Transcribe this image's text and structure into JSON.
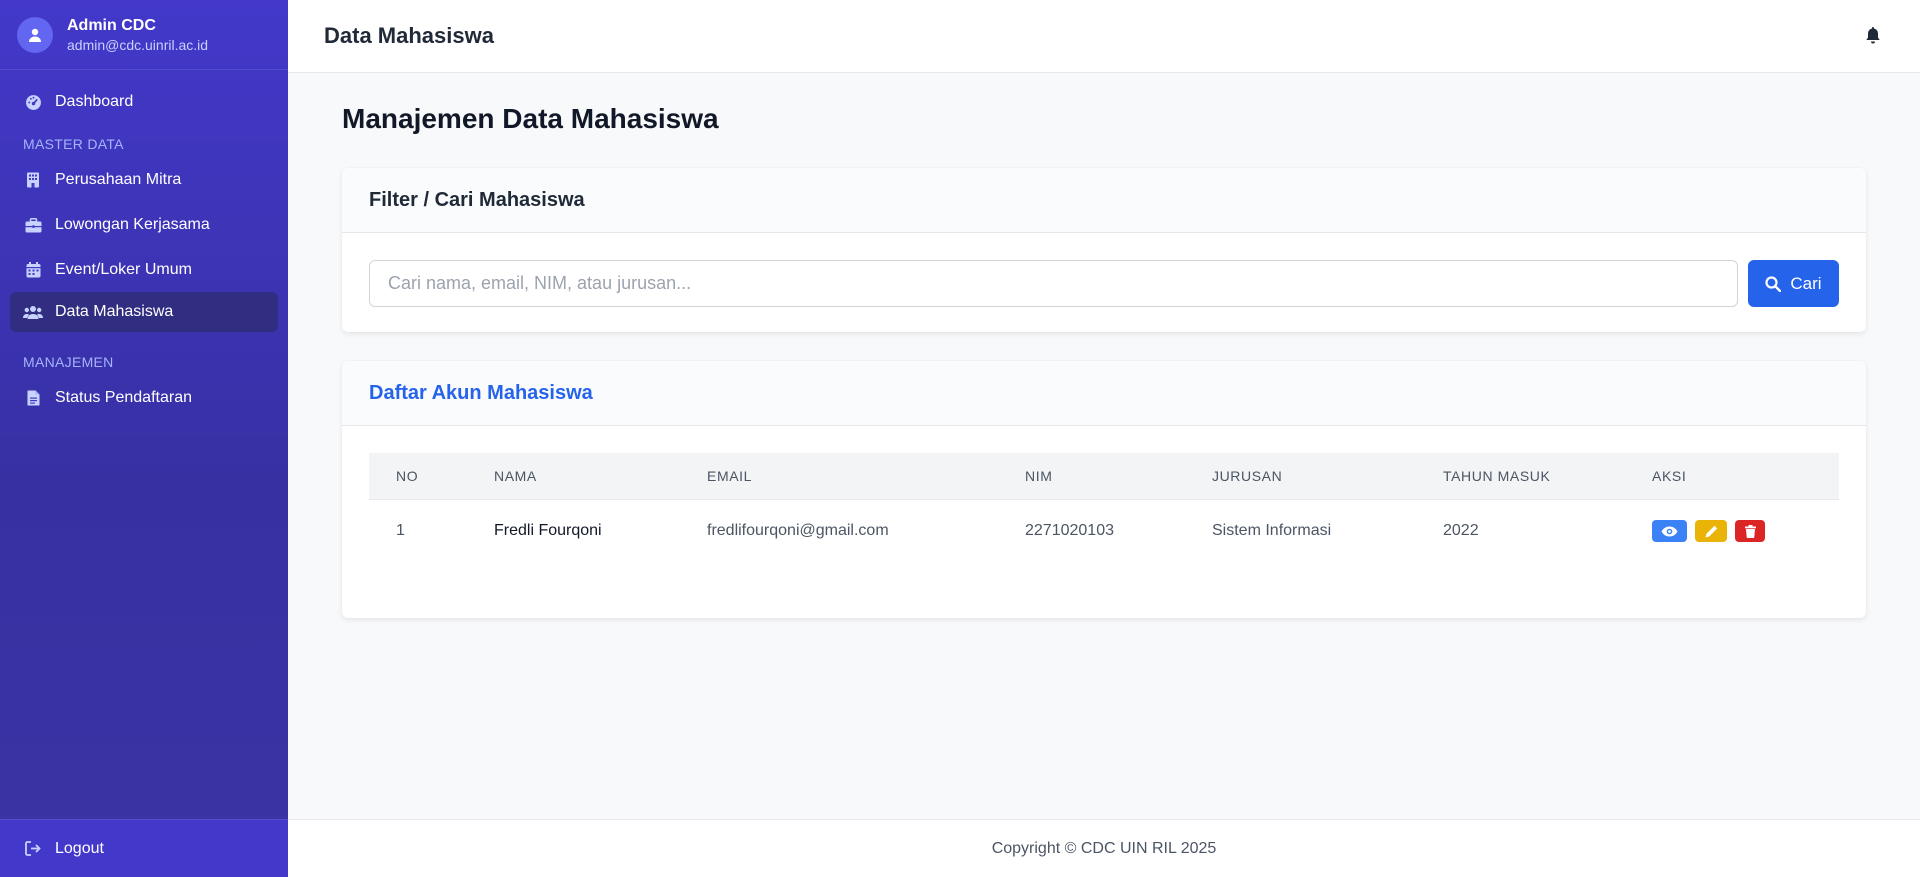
{
  "sidebar": {
    "user": {
      "name": "Admin CDC",
      "email": "admin@cdc.uinril.ac.id",
      "icon": "user-icon"
    },
    "dashboard": {
      "label": "Dashboard",
      "icon": "gauge-icon"
    },
    "section_master": "MASTER DATA",
    "master_items": [
      {
        "label": "Perusahaan Mitra",
        "icon": "building-icon"
      },
      {
        "label": "Lowongan Kerjasama",
        "icon": "briefcase-icon"
      },
      {
        "label": "Event/Loker Umum",
        "icon": "calendar-icon"
      },
      {
        "label": "Data Mahasiswa",
        "icon": "users-icon",
        "active": true
      }
    ],
    "section_manajemen": "MANAJEMEN",
    "manajemen_items": [
      {
        "label": "Status Pendaftaran",
        "icon": "file-icon"
      }
    ],
    "logout": {
      "label": "Logout",
      "icon": "sign-out-icon"
    }
  },
  "header": {
    "title": "Data Mahasiswa",
    "bell_icon": "bell-icon"
  },
  "main": {
    "page_title": "Manajemen Data Mahasiswa",
    "filter": {
      "title": "Filter / Cari Mahasiswa",
      "placeholder": "Cari nama, email, NIM, atau jurusan...",
      "value": "",
      "button_label": "Cari",
      "button_icon": "search-icon"
    },
    "list": {
      "title": "Daftar Akun Mahasiswa",
      "columns": [
        "NO",
        "NAMA",
        "EMAIL",
        "NIM",
        "JURUSAN",
        "TAHUN MASUK",
        "AKSI"
      ],
      "rows": [
        {
          "no": "1",
          "nama": "Fredli Fourqoni",
          "email": "fredlifourqoni@gmail.com",
          "nim": "2271020103",
          "jurusan": "Sistem Informasi",
          "tahun": "2022"
        }
      ],
      "action_icons": [
        "eye-icon",
        "pencil-icon",
        "trash-icon"
      ]
    }
  },
  "footer": {
    "text": "Copyright © CDC UIN RIL 2025"
  },
  "colors": {
    "sidebar_top": "#4338ca",
    "sidebar_active": "#312e81",
    "primary": "#2563eb",
    "view": "#3b82f6",
    "edit": "#eab308",
    "delete": "#dc2626"
  }
}
